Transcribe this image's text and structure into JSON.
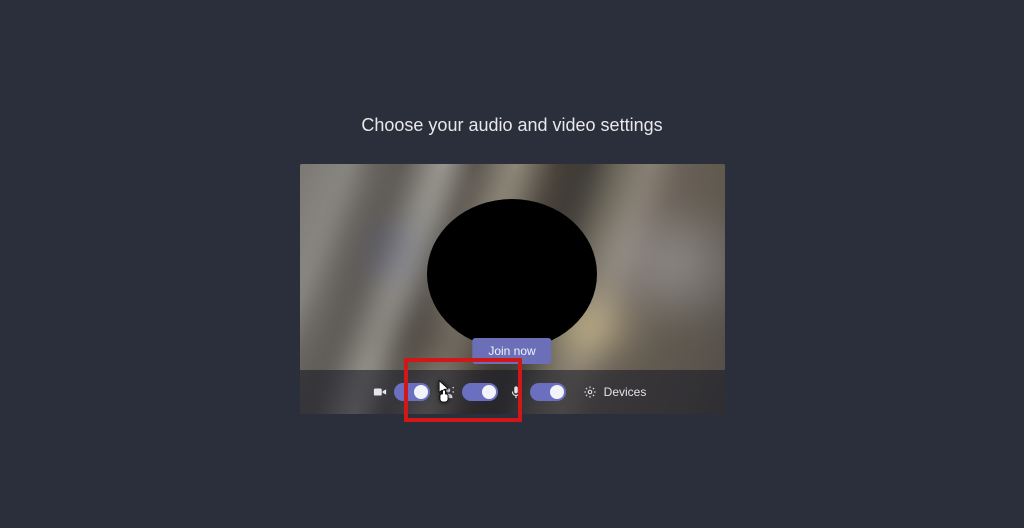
{
  "heading": "Choose your audio and video settings",
  "join_label": "Join now",
  "controls": {
    "camera_toggle_on": true,
    "mic_toggle_on": true,
    "bg_toggle_on": true,
    "devices_label": "Devices"
  },
  "icons": {
    "camera": "camera-icon",
    "mic": "mic-icon",
    "settings": "gear-icon"
  }
}
